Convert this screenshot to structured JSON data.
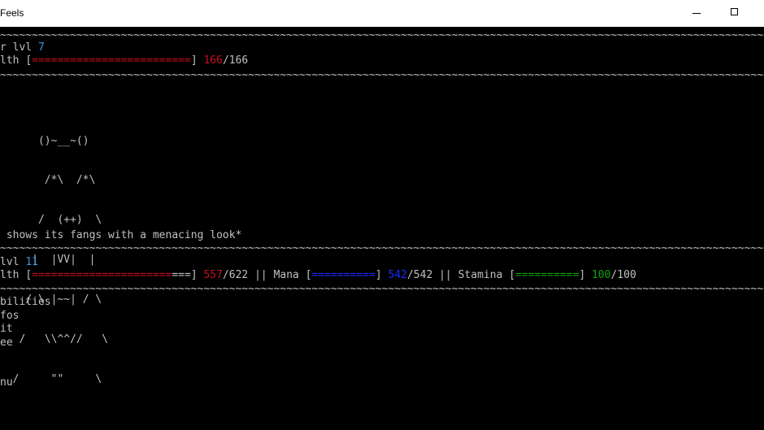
{
  "window": {
    "title": "Feels",
    "minimize_icon": "minimize-icon",
    "maximize_icon": "maximize-icon"
  },
  "separator_text": "~~~~~~~~~~~~~~~~~~~~~~~~~~~~~~~~~~~~~~~~~~~~~~~~~~~~~~~~~~~~~~~~~~~~~~~~~~~~~~~~~~~~~~~~~~~~~~~~~~~~~~~~~~~~~~~~~~~~~~~~~~~~",
  "player": {
    "label": "r lvl ",
    "level": "7",
    "health_label": "lth ",
    "bar_open": "[",
    "bar_fill": "=========================",
    "bar_close": "]",
    "health_current": "166",
    "health_max": "/166"
  },
  "enemy_art": [
    "      ()~__~()",
    "       /*\\  /*\\",
    "      /  (++)  \\",
    "     |  |VV|  |",
    "    / \\ |~~| / \\",
    "   /   \\\\^^//   \\",
    "  /     \"\"     \\"
  ],
  "message": " shows its fangs with a menacing look*",
  "enemy": {
    "label": "lvl ",
    "level": "11",
    "health_label": "lth ",
    "health_bar_red": "======================",
    "health_bar_grey": "===",
    "health_current": "557",
    "health_max": "/622",
    "sep1": " || ",
    "mana_label": "Mana ",
    "mana_bar": "==========",
    "mana_current": "542",
    "mana_max": "/542",
    "sep2": " || ",
    "stamina_label": "Stamina ",
    "stamina_bar": "==========",
    "stamina_current": "100",
    "stamina_max": "/100"
  },
  "menu": [
    "bilities",
    "fos",
    "it",
    "ee",
    "nu"
  ],
  "colors": {
    "background": "#000000",
    "text": "#c0c0c0",
    "cyan": "#3a96dd",
    "red": "#c50f1f",
    "blue": "#1a2cff",
    "green": "#13a10e"
  }
}
